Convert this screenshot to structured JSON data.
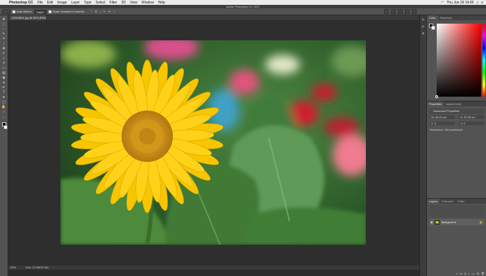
{
  "menubar": {
    "apple_icon": "apple-icon",
    "items": [
      "Photoshop CC",
      "File",
      "Edit",
      "Image",
      "Layer",
      "Type",
      "Select",
      "Filter",
      "3D",
      "View",
      "Window",
      "Help"
    ],
    "datetime": "Thu Jun 29 14:05"
  },
  "window": {
    "title": "Adobe Photoshop CC 2017"
  },
  "options": {
    "auto_select_label": "Auto-Select:",
    "auto_select_value": "Layer",
    "transform_label": "Show Transform Controls"
  },
  "document": {
    "tab_label": "29016601.jpg @ 50% (RGB/8)",
    "zoom": "50%",
    "doc_size": "Doc: 22.9M/22.9M"
  },
  "panels": {
    "color_tabs": [
      "Color",
      "Swatches"
    ],
    "props_tabs": [
      "Properties",
      "Adjustments"
    ],
    "props_title": "Document Properties",
    "props_w": "W: 48.42 cm",
    "props_h": "H: 32.28 cm",
    "props_x": "X: 0",
    "props_y": "Y: 0",
    "resolution": "Resolution: 180 pixels/inch",
    "layers_tabs": [
      "Layers",
      "Channels",
      "Paths"
    ],
    "layer_name": "Background"
  },
  "colors": {
    "accent_red": "#ff0000",
    "flower_yellow": "#f7c600"
  }
}
